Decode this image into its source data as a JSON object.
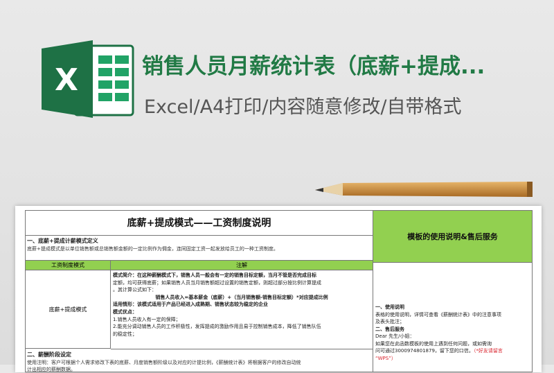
{
  "header": {
    "title": "销售人员月薪统计表（底薪+提成...",
    "subtitle": "Excel/A4打印/内容随意修改/自带格式"
  },
  "logo": {
    "letter": "X",
    "brand_color": "#1e7145"
  },
  "sheet": {
    "doc_title": "底薪+提成模式——工资制度说明",
    "section1_heading": "一、底薪+提成计薪模式定义",
    "section1_text": "底薪+提成模式是以单位销售额或总销售额金额的一定比例作为佣金，连同固定工资一起发放给员工的一种工资制度。",
    "table_header": {
      "col1": "工资制度模式",
      "col2": "注解"
    },
    "mode_name": "底薪+提成模式",
    "notes": {
      "l1": "模式简介：在这种薪酬模式下，销售人员一般会有一定的销售目标定额，当月不管是否完成目标",
      "l2": "定额，均可获得底薪；如果销售人员当月销售额超过设置的销售定额，则超过部分按比例计算提成",
      "l3": "。其计算公式如下：",
      "formula": "销售人员收入=基本薪金（底薪）+（当月销售额-销售目标定额）*对应提成比例",
      "l5": "适用情形：该模式适用于产品已经进入成熟期、销售状态较为稳定的企业",
      "l6": "模式优点：",
      "l7": "1.销售人员收入有一定的保障；",
      "l8": "2.能充分调动销售人员的工作积极性，发挥提成的激励作用且易于控制销售成本，降低了销售队伍",
      "l9": "的稳定性；"
    },
    "section2_heading": "二、薪酬阶段设定",
    "section2_text": "使用注明：客户可根据个人需求修改下表的底薪、月度销售额阶级以及对应的计提比例，《薪酬统计表》将根据客户的修改自动统",
    "section2_text2": "计出相应的薪酬数据。"
  },
  "right_panel": {
    "title": "模板的使用说明&售后服务",
    "h1": "一、使用说明",
    "t1": "表格的使用说明，详情可查看《薪酬统计表》中的注意事项",
    "t2": "及表头批注；",
    "h2": "二、售后服务",
    "t3": "Dear 先生/小姐：",
    "t4": "如果您在此函数模板的使用上遇到任何问题，或如需询",
    "t5a": "问可通过3000974801879，留下您的口信。",
    "t5b": "（*好友请留言",
    "t6": "“WPS”）"
  }
}
